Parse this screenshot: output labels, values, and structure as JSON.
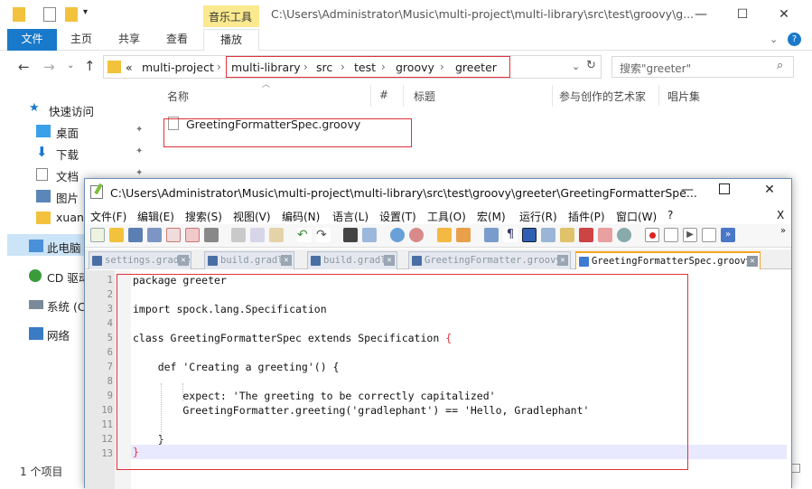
{
  "explorer": {
    "title": "C:\\Users\\Administrator\\Music\\multi-project\\multi-library\\src\\test\\groovy\\g...",
    "context_tab": "音乐工具",
    "ribbon_tabs": [
      "文件",
      "主页",
      "共享",
      "查看",
      "播放"
    ],
    "address_root_marker": "«",
    "breadcrumbs": [
      "multi-project",
      "multi-library",
      "src",
      "test",
      "groovy",
      "greeter"
    ],
    "search_placeholder": "搜索\"greeter\"",
    "columns": [
      "名称",
      "#",
      "标题",
      "参与创作的艺术家",
      "唱片集"
    ],
    "files": [
      "GreetingFormatterSpec.groovy"
    ],
    "nav": [
      "快速访问",
      "桌面",
      "下载",
      "文档",
      "图片",
      "xuan",
      "此电脑",
      "CD 驱动",
      "系统 (C",
      "网络"
    ],
    "status": "1 个项目",
    "help_glyph": "?"
  },
  "npp": {
    "title": "C:\\Users\\Administrator\\Music\\multi-project\\multi-library\\src\\test\\groovy\\greeter\\GreetingFormatterSpe...",
    "menu": [
      "文件(F)",
      "编辑(E)",
      "搜索(S)",
      "视图(V)",
      "编码(N)",
      "语言(L)",
      "设置(T)",
      "工具(O)",
      "宏(M)",
      "运行(R)",
      "插件(P)",
      "窗口(W)",
      "?",
      "X"
    ],
    "tabs": [
      "settings.gradle",
      "build.gradle",
      "build.gradle",
      "GreetingFormatter.groovy",
      "GreetingFormatterSpec.groovy"
    ],
    "line_numbers": [
      "1",
      "2",
      "3",
      "4",
      "5",
      "6",
      "7",
      "8",
      "9",
      "10",
      "11",
      "12",
      "13"
    ],
    "code": {
      "l1": "package greeter",
      "l3": "import spock.lang.Specification",
      "l5a": "class GreetingFormatterSpec extends Specification ",
      "l5b": "{",
      "l7": "    def 'Creating a greeting'() {",
      "l9": "        expect: 'The greeting to be correctly capitalized'",
      "l10": "        GreetingFormatter.greeting('gradlephant') == 'Hello, Gradlephant'",
      "l12": "    }",
      "l13": "}"
    }
  },
  "colors": {
    "ribbon_accent": "#1979ca",
    "highlight_box": "#e2313a",
    "context_tab": "#fbe98f",
    "active_tab": "#f5a623"
  }
}
